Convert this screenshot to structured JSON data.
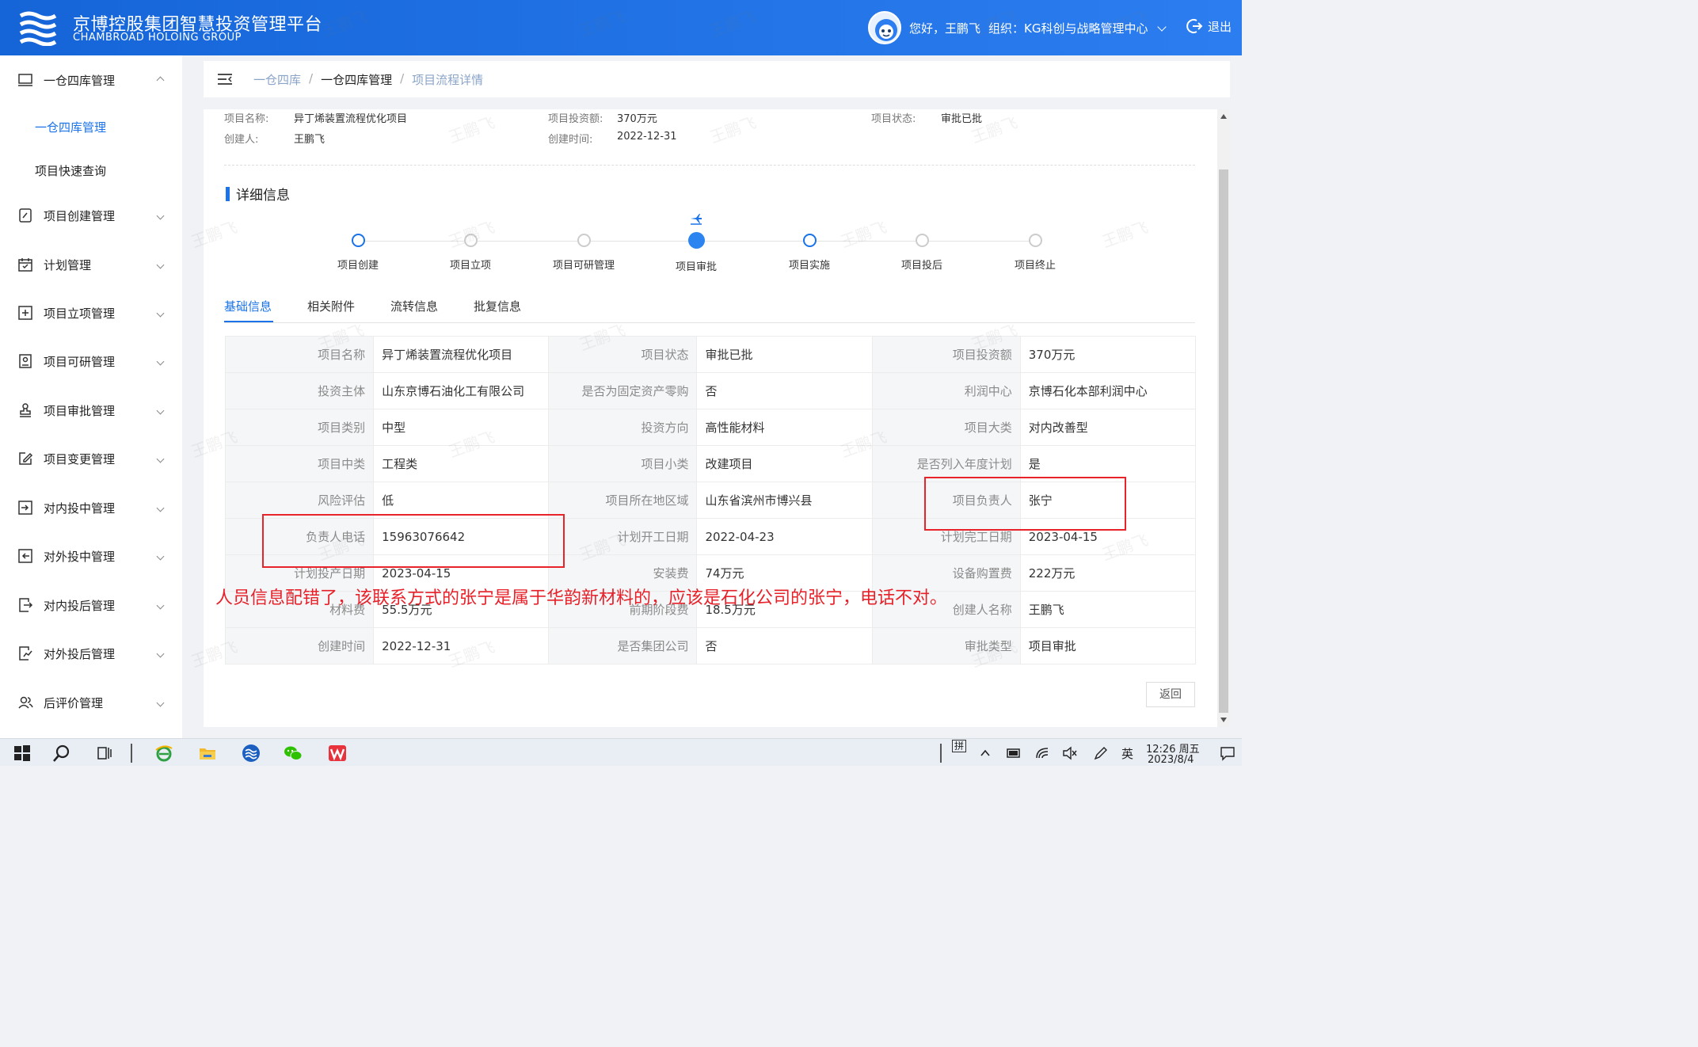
{
  "header": {
    "brand_cn": "京博控股集团智慧投资管理平台",
    "brand_en": "CHAMBROAD HOLOING GROUP",
    "greeting": "您好，王鹏飞",
    "org": "组织：KG科创与战略管理中心",
    "logout": "退出"
  },
  "sidebar": {
    "items": [
      {
        "label": "一仓四库管理",
        "icon": "monitor-icon",
        "expanded": true
      },
      {
        "label": "项目创建管理",
        "icon": "edit-doc-icon"
      },
      {
        "label": "计划管理",
        "icon": "calendar-icon"
      },
      {
        "label": "项目立项管理",
        "icon": "plus-square-icon"
      },
      {
        "label": "项目可研管理",
        "icon": "id-doc-icon"
      },
      {
        "label": "项目审批管理",
        "icon": "stamp-icon"
      },
      {
        "label": "项目变更管理",
        "icon": "pencil-square-icon"
      },
      {
        "label": "对内投中管理",
        "icon": "enter-icon"
      },
      {
        "label": "对外投中管理",
        "icon": "exit-icon"
      },
      {
        "label": "对内投后管理",
        "icon": "doc-arrow-icon"
      },
      {
        "label": "对外投后管理",
        "icon": "doc-chart-icon"
      },
      {
        "label": "后评价管理",
        "icon": "users-icon"
      }
    ],
    "sub_items": [
      {
        "label": "一仓四库管理",
        "active": true
      },
      {
        "label": "项目快速查询",
        "active": false
      }
    ]
  },
  "breadcrumb": [
    "一仓四库",
    "一仓四库管理",
    "项目流程详情"
  ],
  "summary": {
    "name_label": "项目名称:",
    "name": "异丁烯装置流程优化项目",
    "amount_label": "项目投资额:",
    "amount": "370万元",
    "status_label": "项目状态:",
    "status": "审批已批",
    "creator_label": "创建人:",
    "creator": "王鹏飞",
    "created_label": "创建时间:",
    "created": "2022-12-31"
  },
  "section_title": "详细信息",
  "steps": [
    {
      "label": "项目创建",
      "state": "done"
    },
    {
      "label": "项目立项",
      "state": "pending"
    },
    {
      "label": "项目可研管理",
      "state": "pending"
    },
    {
      "label": "项目审批",
      "state": "current"
    },
    {
      "label": "项目实施",
      "state": "done"
    },
    {
      "label": "项目投后",
      "state": "pending"
    },
    {
      "label": "项目终止",
      "state": "pending"
    }
  ],
  "tabs": [
    "基础信息",
    "相关附件",
    "流转信息",
    "批复信息"
  ],
  "table": [
    [
      [
        "项目名称",
        "异丁烯装置流程优化项目"
      ],
      [
        "项目状态",
        "审批已批"
      ],
      [
        "项目投资额",
        "370万元"
      ]
    ],
    [
      [
        "投资主体",
        "山东京博石油化工有限公司"
      ],
      [
        "是否为固定资产零购",
        "否"
      ],
      [
        "利润中心",
        "京博石化本部利润中心"
      ]
    ],
    [
      [
        "项目类别",
        "中型"
      ],
      [
        "投资方向",
        "高性能材料"
      ],
      [
        "项目大类",
        "对内改善型"
      ]
    ],
    [
      [
        "项目中类",
        "工程类"
      ],
      [
        "项目小类",
        "改建项目"
      ],
      [
        "是否列入年度计划",
        "是"
      ]
    ],
    [
      [
        "风险评估",
        "低"
      ],
      [
        "项目所在地区域",
        "山东省滨州市博兴县"
      ],
      [
        "项目负责人",
        "张宁"
      ]
    ],
    [
      [
        "负责人电话",
        "15963076642"
      ],
      [
        "计划开工日期",
        "2022-04-23"
      ],
      [
        "计划完工日期",
        "2023-04-15"
      ]
    ],
    [
      [
        "计划投产日期",
        "2023-04-15"
      ],
      [
        "安装费",
        "74万元"
      ],
      [
        "设备购置费",
        "222万元"
      ]
    ],
    [
      [
        "材料费",
        "55.5万元"
      ],
      [
        "前期阶段费",
        "18.5万元"
      ],
      [
        "创建人名称",
        "王鹏飞"
      ]
    ],
    [
      [
        "创建时间",
        "2022-12-31"
      ],
      [
        "是否集团公司",
        "否"
      ],
      [
        "审批类型",
        "项目审批"
      ]
    ]
  ],
  "back_button": "返回",
  "annotation_note": "人员信息配错了，该联系方式的张宁是属于华韵新材料的，应该是石化公司的张宁，电话不对。",
  "watermark": "王鹏飞",
  "taskbar": {
    "ime": "拼",
    "lang": "英",
    "time": "12:26 周五",
    "date": "2023/8/4"
  },
  "colors": {
    "primary": "#1a73e8",
    "header": "#1e6fe6",
    "annotation": "#e8232a"
  }
}
